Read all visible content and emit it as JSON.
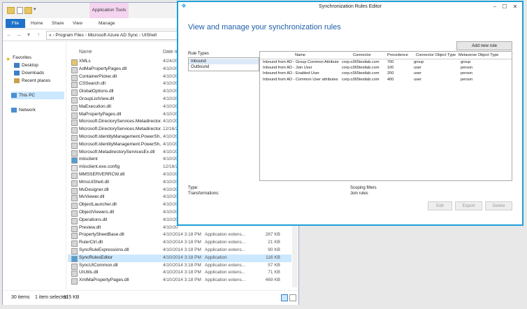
{
  "explorer": {
    "context_tab": "Application Tools",
    "ribbon_tabs": [
      "File",
      "Home",
      "Share",
      "View",
      "Manage"
    ],
    "address_path": [
      "«",
      "Program Files",
      "Microsoft Azure AD Sync",
      "UIShell"
    ],
    "columns": {
      "name": "Name",
      "date": "Date m"
    },
    "nav": {
      "favorites": "Favorites",
      "desktop": "Desktop",
      "downloads": "Downloads",
      "recent": "Recent places",
      "this_pc": "This PC",
      "network": "Network"
    },
    "files": [
      {
        "name": "XMLs",
        "date": "4/24/20",
        "type": "",
        "size": "",
        "kind": "folder"
      },
      {
        "name": "AdMaPropertyPages.dll",
        "date": "4/10/20",
        "type": "",
        "size": "",
        "kind": "dll"
      },
      {
        "name": "ContainerPicker.dll",
        "date": "4/10/20",
        "type": "",
        "size": "",
        "kind": "dll"
      },
      {
        "name": "CSSearch.dll",
        "date": "4/10/20",
        "type": "",
        "size": "",
        "kind": "dll"
      },
      {
        "name": "GlobalOptions.dll",
        "date": "4/10/20",
        "type": "",
        "size": "",
        "kind": "dll"
      },
      {
        "name": "GroupListView.dll",
        "date": "4/10/20",
        "type": "",
        "size": "",
        "kind": "dll"
      },
      {
        "name": "MaExecution.dll",
        "date": "4/10/20",
        "type": "",
        "size": "",
        "kind": "dll"
      },
      {
        "name": "MaPropertyPages.dll",
        "date": "4/10/20",
        "type": "",
        "size": "",
        "kind": "dll"
      },
      {
        "name": "Microsoft.DirectoryServices.Metadirector...",
        "date": "4/10/20",
        "type": "",
        "size": "",
        "kind": "dll"
      },
      {
        "name": "Microsoft.DirectoryServices.Metadirector...",
        "date": "12/16/2",
        "type": "",
        "size": "",
        "kind": "dll"
      },
      {
        "name": "Microsoft.IdentityManagement.PowerSh...",
        "date": "4/10/20",
        "type": "",
        "size": "",
        "kind": "dll"
      },
      {
        "name": "Microsoft.IdentityManagement.PowerSh...",
        "date": "4/10/20",
        "type": "",
        "size": "",
        "kind": "dll"
      },
      {
        "name": "Microsoft.MetadirectoryServicesEx.dll",
        "date": "4/10/20",
        "type": "",
        "size": "",
        "kind": "dll"
      },
      {
        "name": "miisclient",
        "date": "4/10/20",
        "type": "",
        "size": "",
        "kind": "app"
      },
      {
        "name": "miisclient.exe.config",
        "date": "12/16/2",
        "type": "",
        "size": "",
        "kind": "cfg"
      },
      {
        "name": "MMSSERVERRCW.dll",
        "date": "4/10/20",
        "type": "",
        "size": "",
        "kind": "dll"
      },
      {
        "name": "MmsUiShell.dll",
        "date": "4/10/20",
        "type": "",
        "size": "",
        "kind": "dll"
      },
      {
        "name": "MvDesigner.dll",
        "date": "4/10/20",
        "type": "",
        "size": "",
        "kind": "dll"
      },
      {
        "name": "MvViewer.dll",
        "date": "4/10/20",
        "type": "",
        "size": "",
        "kind": "dll"
      },
      {
        "name": "ObjectLauncher.dll",
        "date": "4/10/20",
        "type": "",
        "size": "",
        "kind": "dll"
      },
      {
        "name": "ObjectViewers.dll",
        "date": "4/10/20",
        "type": "",
        "size": "",
        "kind": "dll"
      },
      {
        "name": "Operations.dll",
        "date": "4/10/20",
        "type": "",
        "size": "",
        "kind": "dll"
      },
      {
        "name": "Preview.dll",
        "date": "4/10/20",
        "type": "",
        "size": "",
        "kind": "dll"
      },
      {
        "name": "PropertySheetBase.dll",
        "date": "4/10/2014 3:18 PM",
        "type": "Application extens...",
        "size": "287 KB",
        "kind": "dll"
      },
      {
        "name": "RulerCtrl.dll",
        "date": "4/10/2014 3:18 PM",
        "type": "Application extens...",
        "size": "21 KB",
        "kind": "dll"
      },
      {
        "name": "SyncRuleExpressions.dll",
        "date": "4/10/2014 3:18 PM",
        "type": "Application extens...",
        "size": "90 KB",
        "kind": "dll"
      },
      {
        "name": "SyncRulesEditor",
        "date": "4/10/2014 3:18 PM",
        "type": "Application",
        "size": "116 KB",
        "kind": "app",
        "selected": true
      },
      {
        "name": "SyncUICommon.dll",
        "date": "4/10/2014 3:18 PM",
        "type": "Application extens...",
        "size": "57 KB",
        "kind": "dll"
      },
      {
        "name": "UIUtils.dll",
        "date": "4/10/2014 3:18 PM",
        "type": "Application extens...",
        "size": "71 KB",
        "kind": "dll"
      },
      {
        "name": "XmlMaPropertyPages.dll",
        "date": "4/10/2014 3:18 PM",
        "type": "Application extens...",
        "size": "469 KB",
        "kind": "dll"
      }
    ],
    "status": {
      "items": "30 items",
      "selected": "1 item selected",
      "size": "115 KB"
    }
  },
  "sync": {
    "title": "Synchronization Rules Editor",
    "heading": "View and manage your synchronization rules",
    "add_button": "Add new rule",
    "rule_types_label": "Rule Types",
    "rule_types": [
      "Inbound",
      "Outbound"
    ],
    "grid_headers": [
      "Name",
      "Connector",
      "Precedence",
      "Connector Object Type",
      "Metaverse Object Type"
    ],
    "rules": [
      [
        "Inbound from AD - Group Common Attribute",
        "corp.o365testlab.com",
        "700",
        "group",
        "group"
      ],
      [
        "Inbound from AD - Join User",
        "corp.o365testlab.com",
        "100",
        "user",
        "person"
      ],
      [
        "Inbound from AD - Enabled User",
        "corp.o365testlab.com",
        "200",
        "user",
        "person"
      ],
      [
        "Inbound from AD - Common User attributes",
        "corp.o365testlab.com",
        "400",
        "user",
        "person"
      ]
    ],
    "details": {
      "type": "Type:",
      "transformations": "Transformations:",
      "scoping": "Scoping filters",
      "join": "Join rules"
    },
    "buttons": {
      "edit": "Edit",
      "export": "Export",
      "delete": "Delete"
    }
  },
  "colors": {
    "accent": "#1da0d8",
    "heading": "#1f5fa8",
    "file_tab": "#1e72c8",
    "selection": "#cce8ff",
    "context_tab": "#f5d4f0"
  }
}
